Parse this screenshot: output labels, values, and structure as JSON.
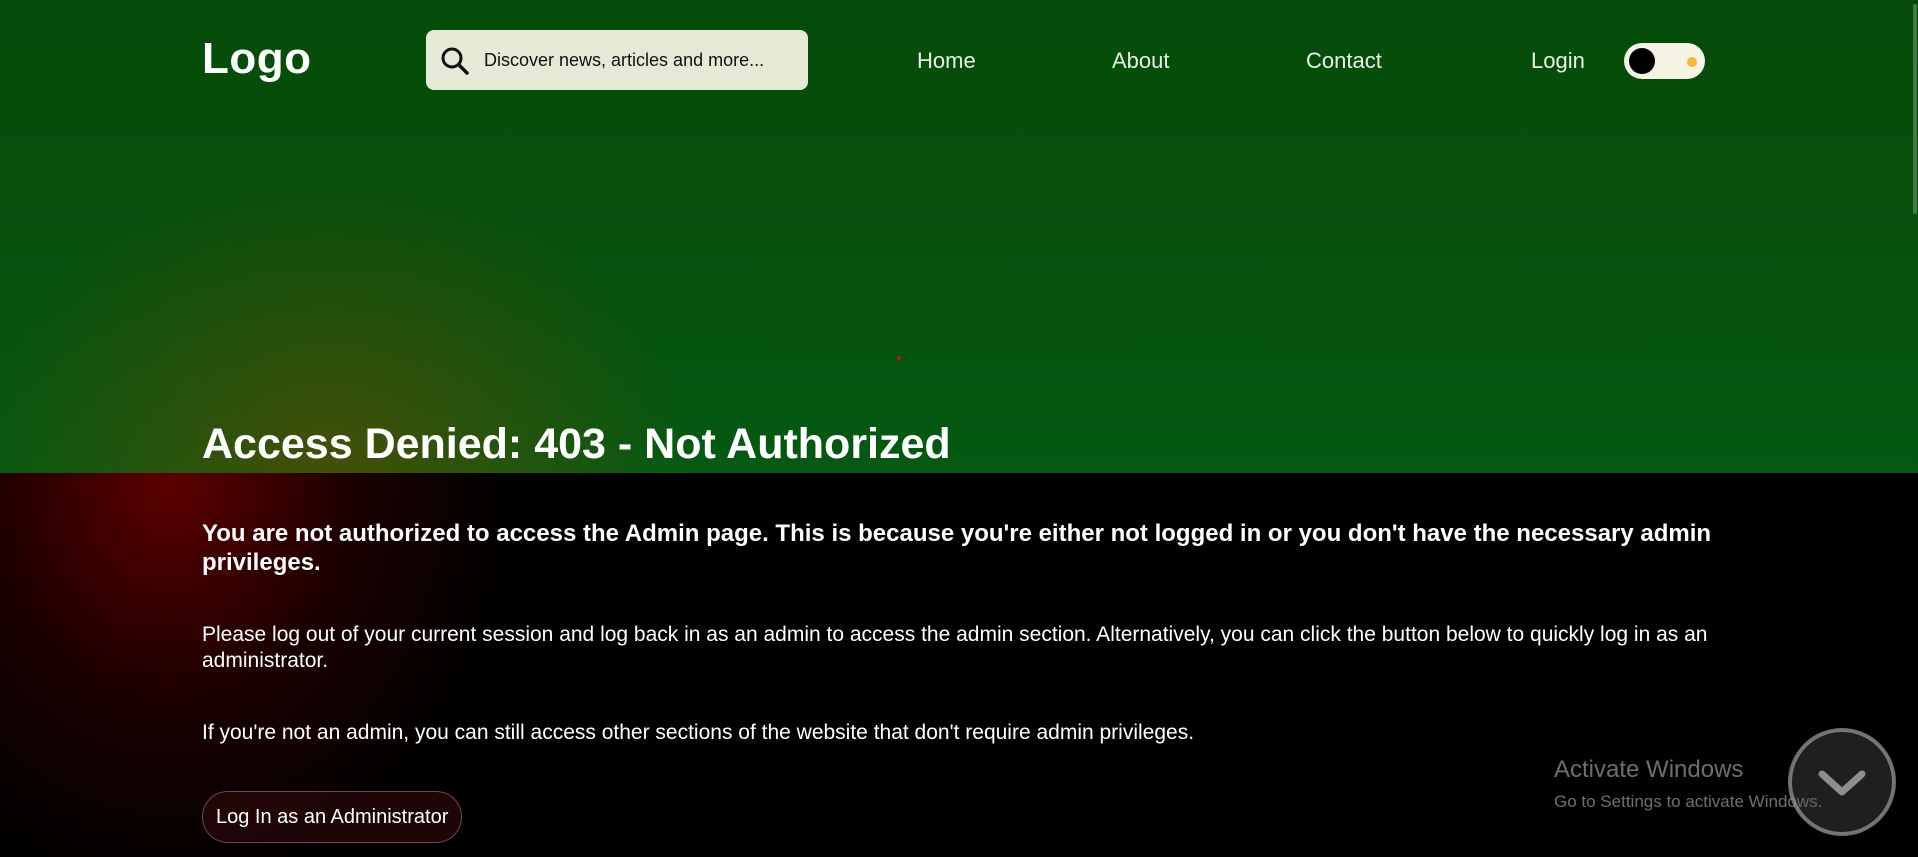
{
  "header": {
    "logo": "Logo",
    "search": {
      "placeholder": "Discover news, articles and more...",
      "value": ""
    },
    "nav": {
      "home": "Home",
      "about": "About",
      "contact": "Contact",
      "login": "Login"
    },
    "theme_toggle": {
      "state": "dark",
      "knob_color": "#000000",
      "indicator_color": "#f5b82e"
    }
  },
  "main": {
    "title": "Access Denied: 403 - Not Authorized",
    "lead": "You are not authorized to access the Admin page. This is because you're either not logged in or you don't have the necessary admin privileges.",
    "paragraph_1": "Please log out of your current session and log back in as an admin to access the admin section. Alternatively, you can click the button below to quickly log in as an administrator.",
    "paragraph_2": "If you're not an admin, you can still access other sections of the website that don't require admin privileges.",
    "admin_button": "Log In as an Administrator"
  },
  "overlay": {
    "watermark_title": "Activate Windows",
    "watermark_sub": "Go to Settings to activate Windows."
  },
  "icons": {
    "search": "search-icon",
    "scroll_down": "chevron-down-icon"
  },
  "colors": {
    "header_green": "#054c0a",
    "search_bg": "#e6e9d6",
    "text": "#ffffff",
    "dark_red_glow": "#6e0000"
  }
}
